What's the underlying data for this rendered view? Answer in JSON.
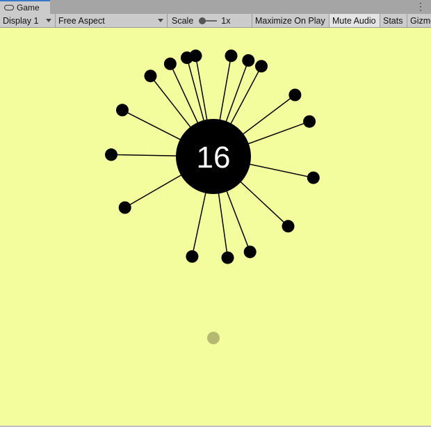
{
  "window": {
    "tab_title": "Game",
    "tab_icon": "gamepad-icon",
    "more_icon": "kebab-menu-icon"
  },
  "toolbar": {
    "display": "Display 1",
    "aspect": "Free Aspect",
    "scale_label": "Scale",
    "scale_value": "1x",
    "maximize": "Maximize On Play",
    "mute": "Mute Audio",
    "stats": "Stats",
    "gizmos": "Gizmos"
  },
  "game": {
    "score": "16",
    "background_color": "#f4fd9e",
    "ball_color": "#000000",
    "pending_ball_color": "#b5b96f",
    "pin_angles_deg": [
      -105,
      -100,
      -80,
      -70,
      -62,
      -115,
      -128,
      -153,
      -179,
      -37,
      -20,
      12,
      43,
      69,
      82,
      102,
      150
    ]
  }
}
